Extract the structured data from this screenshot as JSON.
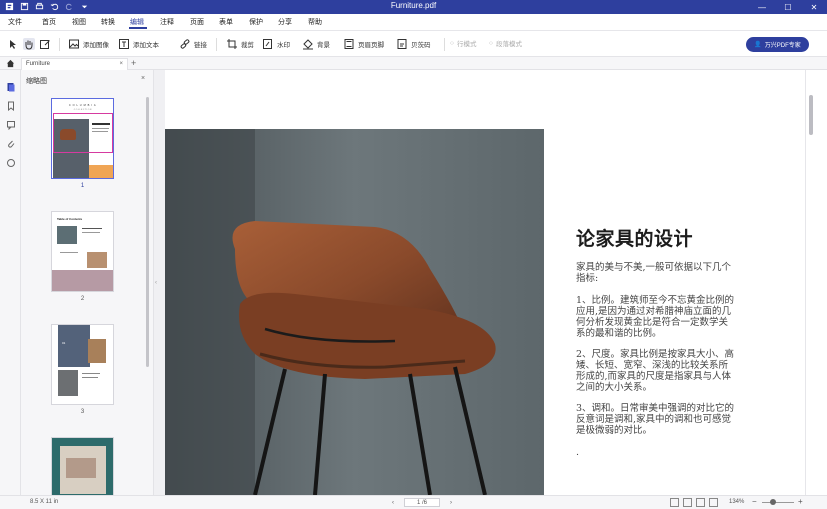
{
  "window": {
    "title": "Furniture.pdf"
  },
  "menu": {
    "items": [
      "文件",
      "首页",
      "视图",
      "转换",
      "编辑",
      "注释",
      "页面",
      "表单",
      "保护",
      "分享",
      "帮助"
    ],
    "active": "编辑"
  },
  "toolbar": {
    "add_image": "添加图像",
    "add_text": "添加文本",
    "link": "链接",
    "crop": "裁剪",
    "watermark": "水印",
    "background": "背景",
    "header_footer": "页眉页脚",
    "bates": "贝茨码",
    "line_mode": "行模式",
    "paragraph_mode": "段落模式",
    "upgrade": "万兴PDF专家"
  },
  "tab": {
    "name": "Furniture",
    "close": "×",
    "add": "+"
  },
  "thumbnails": {
    "title": "缩略图",
    "close": "×",
    "pages": [
      "1",
      "2",
      "3"
    ],
    "selected": "1"
  },
  "thumb_texts": {
    "p1_brand": "C O L U M B I A",
    "p1_sub": "C O L L E C T I O N",
    "p2_title": "Table of Contents",
    "p3_title": "01"
  },
  "document": {
    "heading": "论家具的设计",
    "intro": "家具的美与不美,一般可依据以下几个指标:",
    "p1": "1、比例。建筑师至今不忘黄金比例的应用,是因为通过对希腊神庙立面的几何分析发现黄金比是符合一定数学关系的最和谐的比例。",
    "p2": "2、尺度。家具比例是按家具大小、高矮、长短、宽窄、深浅的比较关系所形成的,而家具的尺度是指家具与人体之间的大小关系。",
    "p3": "3、调和。日常审美中强调的对比它的反意词是调和,家具中的调和也可感觉是极微弱的对比。",
    "trailing": "."
  },
  "status": {
    "page_size": "8.5 X 11 in",
    "page_indicator": "1 /6",
    "zoom": "134%",
    "zoom_minus": "−",
    "zoom_plus": "+"
  },
  "colors": {
    "accent": "#2e3f9e",
    "chair": "#8a4a2b"
  }
}
